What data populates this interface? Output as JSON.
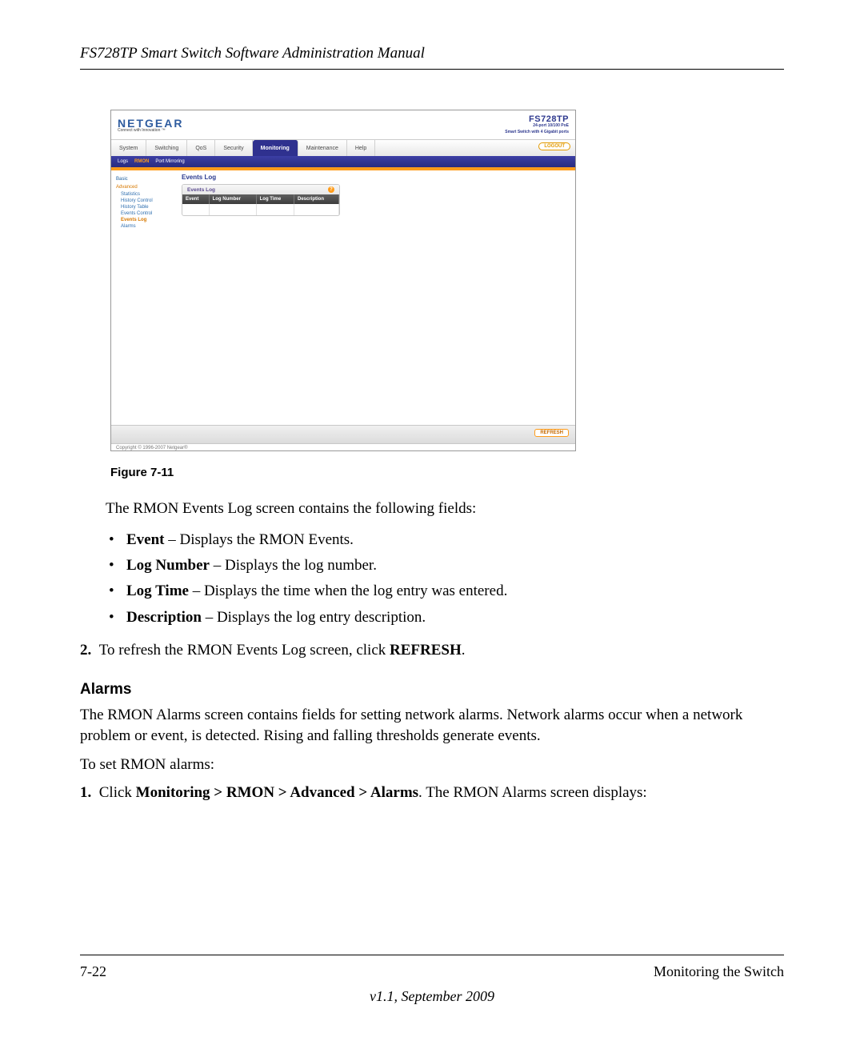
{
  "header": {
    "title": "FS728TP Smart Switch Software Administration Manual"
  },
  "screenshot": {
    "brand": "NETGEAR",
    "tagline": "Connect with Innovation ™",
    "model": "FS728TP",
    "model_sub1": "24-port 10/100 PoE",
    "model_sub2": "Smart Switch with 4 Gigabit ports",
    "main_tabs": [
      "System",
      "Switching",
      "QoS",
      "Security",
      "Monitoring",
      "Maintenance",
      "Help"
    ],
    "main_tab_active": "Monitoring",
    "logout": "LOGOUT",
    "sub_tabs": [
      "Logs",
      "RMON",
      "Port Mirroring"
    ],
    "sub_tab_active": "RMON",
    "sidebar": {
      "basic": "Basic",
      "advanced": "Advanced",
      "items": [
        "Statistics",
        "History Control",
        "History Table",
        "Events Control",
        "Events Log",
        "Alarms"
      ],
      "active": "Events Log"
    },
    "section_title": "Events Log",
    "box_title": "Events Log",
    "columns": [
      "Event",
      "Log Number",
      "Log Time",
      "Description"
    ],
    "refresh": "REFRESH",
    "copyright": "Copyright © 1996-2007 Netgear®"
  },
  "figure_caption": "Figure 7-11",
  "intro_para": "The RMON Events Log screen contains the following fields:",
  "bullets": [
    {
      "term": "Event",
      "desc": " – Displays the RMON Events."
    },
    {
      "term": "Log Number",
      "desc": " – Displays the log number."
    },
    {
      "term": "Log Time",
      "desc": " – Displays the time when the log entry was entered."
    },
    {
      "term": "Description",
      "desc": " – Displays the log entry description."
    }
  ],
  "step2": {
    "num": "2.",
    "pre": "To refresh the RMON Events Log screen, click ",
    "bold": "REFRESH",
    "post": "."
  },
  "alarms": {
    "heading": "Alarms",
    "para": "The RMON Alarms screen contains fields for setting network alarms. Network alarms occur when a network problem or event, is detected. Rising and falling thresholds generate events.",
    "lead": "To set RMON alarms:",
    "step1": {
      "num": "1.",
      "pre": "Click ",
      "bold": "Monitoring > RMON > Advanced > Alarms",
      "post": ". The RMON Alarms screen displays:"
    }
  },
  "footer": {
    "page": "7-22",
    "section": "Monitoring the Switch",
    "version": "v1.1, September 2009"
  }
}
